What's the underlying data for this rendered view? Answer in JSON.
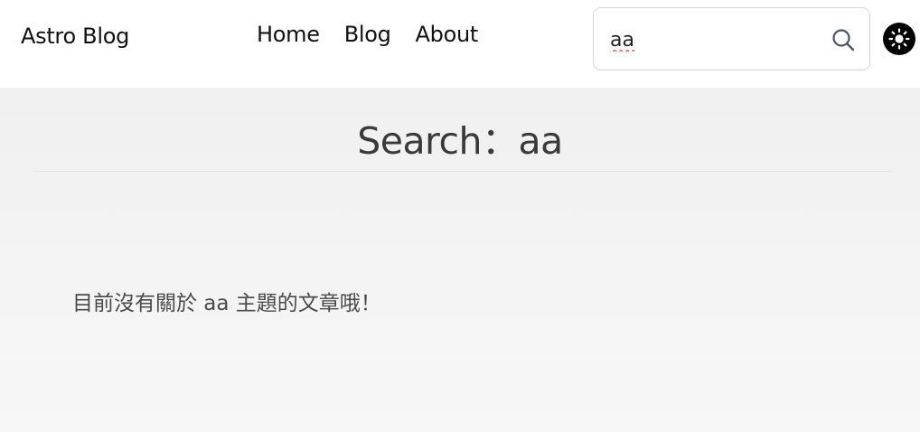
{
  "header": {
    "logo": "Astro Blog",
    "nav": [
      {
        "label": "Home"
      },
      {
        "label": "Blog"
      },
      {
        "label": "About"
      }
    ],
    "search": {
      "value": "aa",
      "icon": "search-icon"
    },
    "theme_toggle": {
      "icon": "sun-icon"
    }
  },
  "main": {
    "title": "Search：aa",
    "empty_message": "目前沒有關於 aa 主題的文章哦！"
  },
  "colors": {
    "header_bg": "#ffffff",
    "page_bg": "#f2f2f2",
    "text": "#111111",
    "toggle_bg": "#000000"
  }
}
